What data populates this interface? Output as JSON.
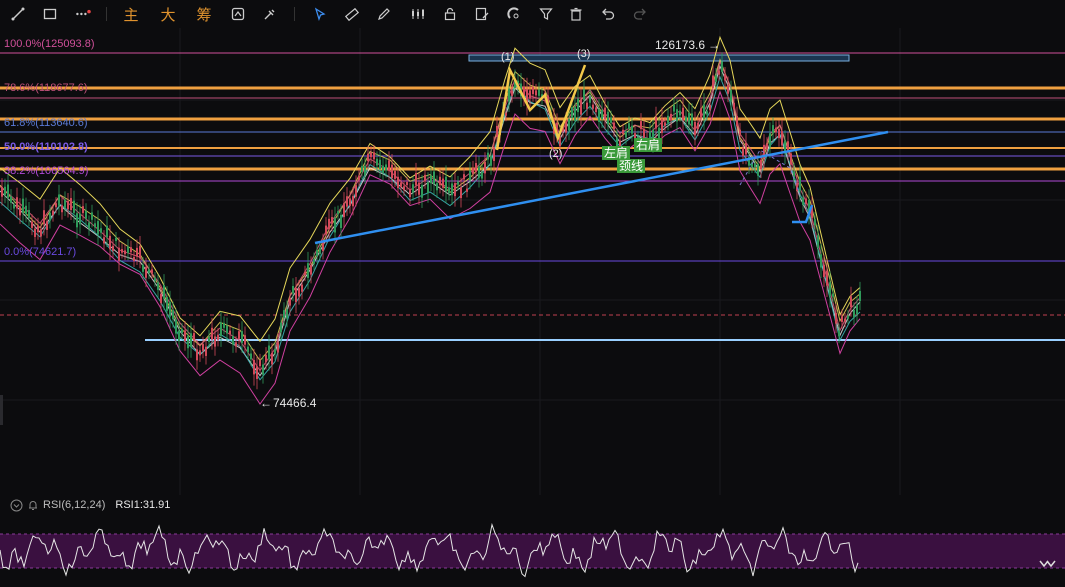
{
  "toolbar": {
    "indicator_labels": [
      "主",
      "大",
      "筹"
    ],
    "tools": [
      "line-tool-icon",
      "rectangle-tool-icon",
      "more-tools-icon",
      "screenshot-icon",
      "magnet-icon",
      "cursor-icon",
      "ruler-icon",
      "brush-icon",
      "candle-style-icon",
      "lock-icon",
      "note-icon",
      "magnet-link-icon",
      "filter-icon",
      "trash-icon",
      "undo-icon",
      "redo-icon"
    ]
  },
  "fib_levels": [
    {
      "label": "100.0%(125093.8)",
      "color": "#d0509a"
    },
    {
      "label": "78.6%(118677.6)",
      "color": "#c0507a"
    },
    {
      "label": "61.8%(113640.6)",
      "color": "#5a7ad6"
    },
    {
      "label": "50.0%(110102.8)",
      "color": "#7a5ae6"
    },
    {
      "label": "38.2%(106564.9)",
      "color": "#b04ad6"
    },
    {
      "label": "0.0%(74621.7)",
      "color": "#6a4ae0"
    }
  ],
  "annotations": {
    "high_price": "126173.6",
    "low_price": "74466.4",
    "wave_1": "(1)",
    "wave_2": "(2)",
    "wave_3": "(3)",
    "left_shoulder": "左肩",
    "right_shoulder": "右肩",
    "neckline": "颈线"
  },
  "rsi": {
    "name": "RSI(6,12,24)",
    "value_label": "RSI1:31.91"
  },
  "colors": {
    "background": "#0c0c0e",
    "candle_up": "#2f9a5a",
    "candle_down": "#d24a5a",
    "orange_level": "#f0a040",
    "trend_line": "#2f8ff0",
    "rsi_band": "#3a1040"
  }
}
